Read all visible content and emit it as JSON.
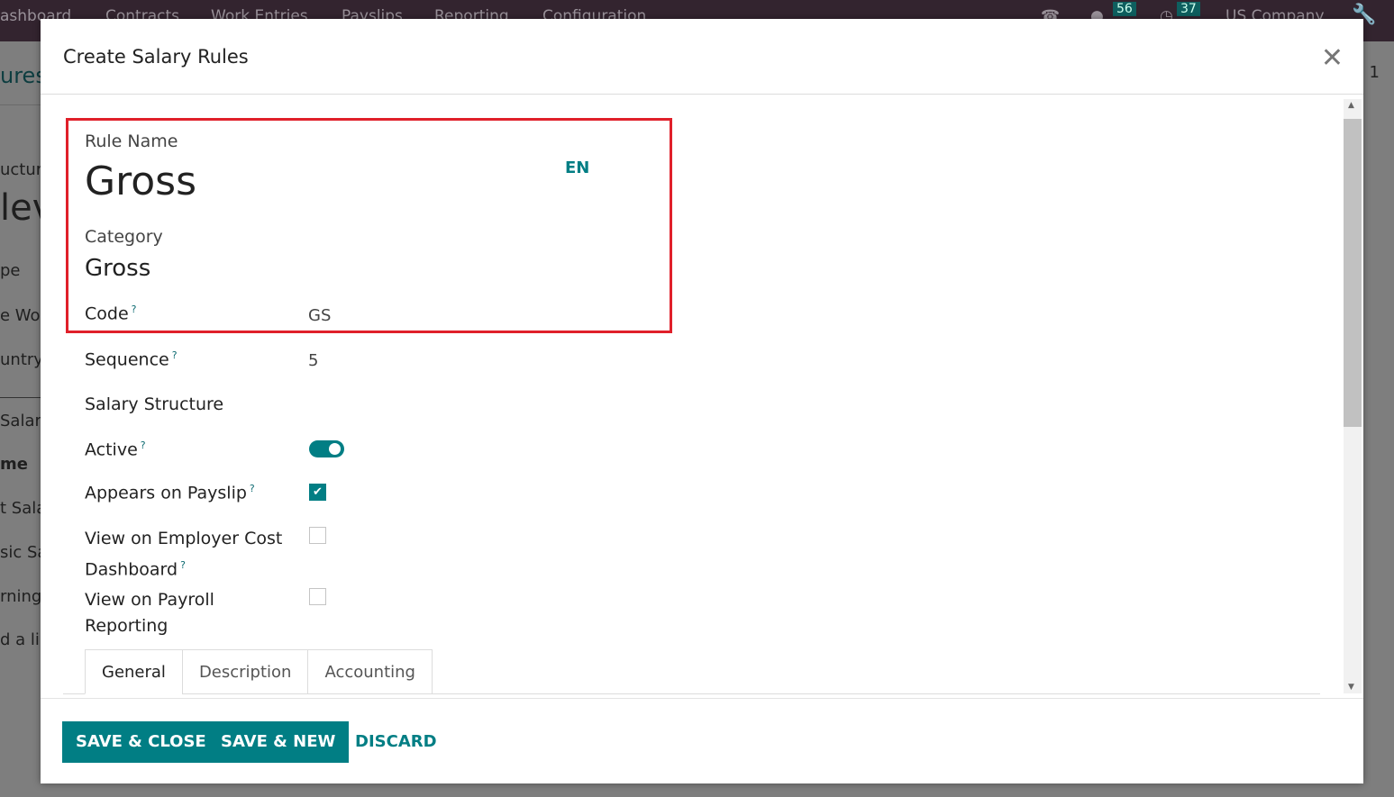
{
  "navbar": {
    "menu": [
      "ashboard",
      "Contracts",
      "Work Entries",
      "Payslips",
      "Reporting",
      "Configuration"
    ],
    "messages_count": "56",
    "activities_count": "37",
    "company": "US Company"
  },
  "background": {
    "items": [
      "ures",
      "uctur",
      "lev",
      "pe",
      "e Wor",
      "untry",
      "Salary",
      "me",
      "t Sala",
      "sic Sa",
      "rnings",
      "d a lir"
    ],
    "pager": "1"
  },
  "modal": {
    "title": "Create Salary Rules",
    "fields": {
      "rule_name_label": "Rule Name",
      "rule_name": "Gross",
      "lang": "EN",
      "category_label": "Category",
      "category": "Gross",
      "code_label": "Code",
      "code": "GS",
      "sequence_label": "Sequence",
      "sequence": "5",
      "salary_structure_label": "Salary Structure",
      "active_label": "Active",
      "active": true,
      "appears_label": "Appears on Payslip",
      "appears": true,
      "employer_cost_label_1": "View on Employer Cost",
      "employer_cost_label_2": "Dashboard",
      "employer_cost": false,
      "payroll_reporting_label_1": "View on Payroll",
      "payroll_reporting_label_2": "Reporting",
      "payroll_reporting": false,
      "help": "?"
    },
    "tabs": [
      "General",
      "Description",
      "Accounting"
    ],
    "footer": {
      "save_close": "SAVE & CLOSE",
      "save_new": "SAVE & NEW",
      "discard": "DISCARD"
    }
  },
  "colors": {
    "primary": "#017e84",
    "highlight": "#e0202a",
    "navbar": "#33242f"
  }
}
